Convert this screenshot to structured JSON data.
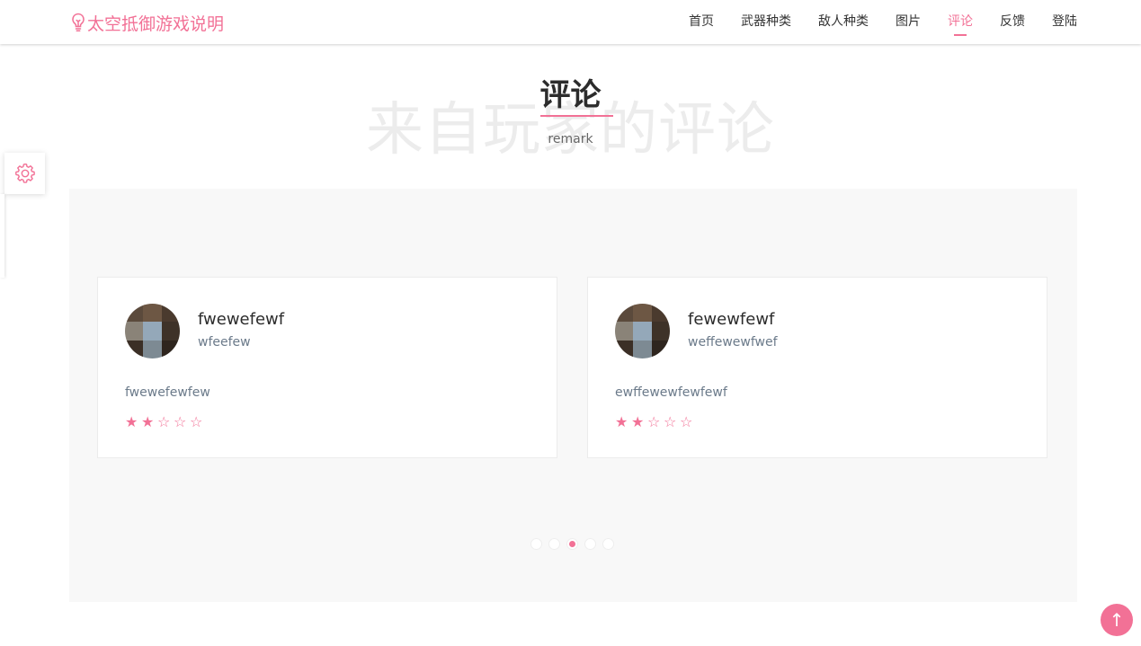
{
  "brand": {
    "title": "太空抵御游戏说明",
    "icon": "lightbulb-icon"
  },
  "nav": {
    "items": [
      {
        "label": "首页"
      },
      {
        "label": "武器种类"
      },
      {
        "label": "敌人种类"
      },
      {
        "label": "图片"
      },
      {
        "label": "评论",
        "active": true
      },
      {
        "label": "反馈"
      },
      {
        "label": "登陆"
      }
    ]
  },
  "section": {
    "background_text": "来自玩家的评论",
    "title": "评论",
    "subtitle": "remark"
  },
  "reviews": [
    {
      "name": "fwewefewf",
      "handle": "wfeefew",
      "comment": "fwewefewfew",
      "rating": 2,
      "max_rating": 5
    },
    {
      "name": "fewewfewf",
      "handle": "weffewewfwef",
      "comment": "ewffewewfewfewf",
      "rating": 2,
      "max_rating": 5
    }
  ],
  "carousel": {
    "count": 5,
    "active_index": 2
  },
  "widgets": {
    "settings_icon": "gear-icon",
    "back_to_top_icon": "arrow-up-icon",
    "back_to_top_symbol": "↑"
  },
  "colors": {
    "accent": "#f27196",
    "panel_bg": "#f8f8f8",
    "text_dark": "#2c2c2c",
    "text_muted": "#6b7a8a"
  }
}
